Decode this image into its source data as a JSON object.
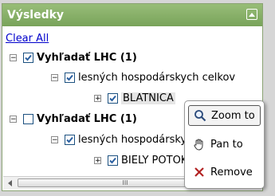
{
  "panel": {
    "title": "Výsledky",
    "clear_all": "Clear All"
  },
  "tree": {
    "node1_label": "Vyhľadať LHC (1)",
    "node1_child_label": "lesných hospodárskych celkov",
    "node1_leaf_label": "BLATNICA",
    "node2_label": "Vyhľadať LHC (1)",
    "node2_child_label": "lesných hospodárskych celkov",
    "node2_leaf_label": "BIELY POTOK"
  },
  "scrollbar": {
    "grip": "III"
  },
  "context_menu": {
    "zoom_to": "Zoom to",
    "pan_to": "Pan to",
    "remove": "Remove"
  },
  "colors": {
    "header": "#88b06a",
    "link": "#0000cc",
    "remove_icon": "#b22222"
  }
}
